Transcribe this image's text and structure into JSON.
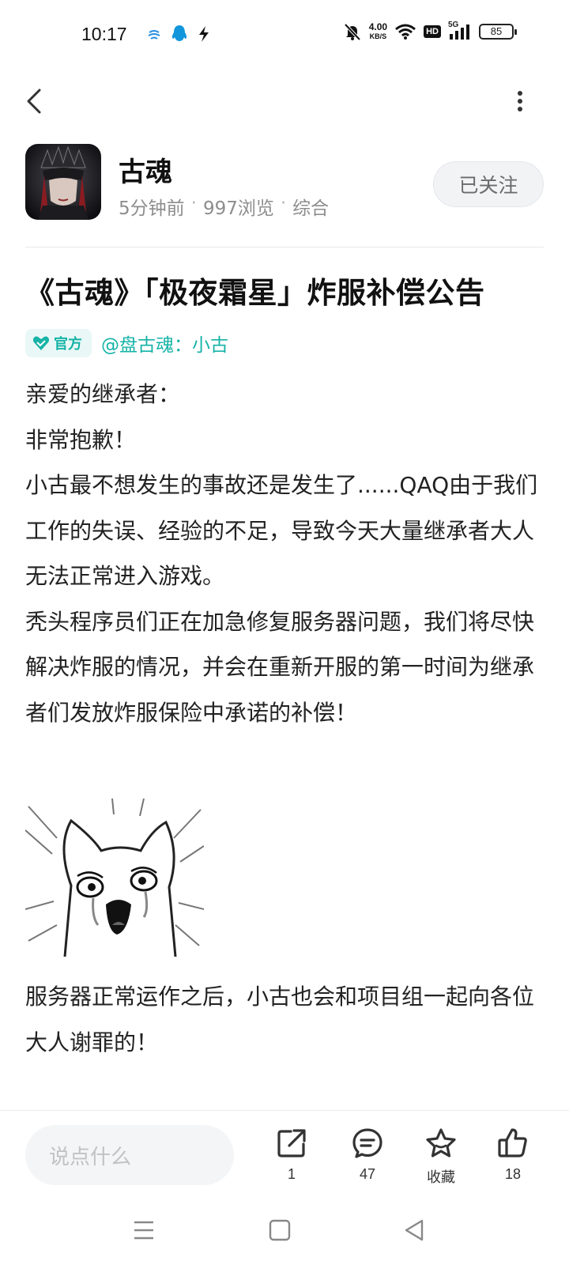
{
  "status_bar": {
    "time": "10:17",
    "net_speed_value": "4.00",
    "net_speed_unit": "KB/S",
    "hd_label": "HD",
    "network_label": "5G",
    "battery": "85"
  },
  "author": {
    "name": "古魂",
    "time_ago": "5分钟前",
    "sep1": "·",
    "views": "997浏览",
    "sep2": "·",
    "category": "综合",
    "follow_label": "已关注"
  },
  "post": {
    "title": "《古魂》「极夜霜星」炸服补偿公告",
    "official_tag": "官方",
    "mention": "@盘古魂：小古",
    "paragraphs": [
      "亲爱的继承者：",
      "非常抱歉！",
      "小古最不想发生的事故还是发生了......QAQ由于我们工作的失误、经验的不足，导致今天大量继承者大人无法正常进入游戏。",
      "秃头程序员们正在加急修复服务器问题，我们将尽快解决炸服的情况，并会在重新开服的第一时间为继承者们发放炸服保险中承诺的补偿！"
    ],
    "closing": "服务器正常运作之后，小古也会和项目组一起向各位大人谢罪的！"
  },
  "action_bar": {
    "comment_placeholder": "说点什么",
    "share_count": "1",
    "comment_count": "47",
    "favorite_label": "收藏",
    "like_count": "18"
  },
  "colors": {
    "accent": "#16b3a7",
    "text": "#222222",
    "muted": "#8d8d8d"
  },
  "icons": {
    "back": "chevron-left-icon",
    "more": "more-vertical-icon",
    "share": "share-icon",
    "comment": "comment-icon",
    "favorite": "star-icon",
    "like": "thumbs-up-icon"
  }
}
